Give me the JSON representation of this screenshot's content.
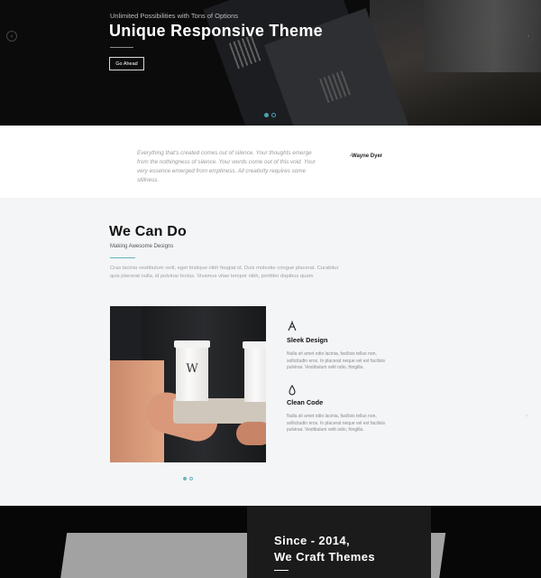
{
  "hero": {
    "kicker": "Unlimited Possibilities with Tons of Options",
    "title": "Unique Responsive Theme",
    "button_label": "Go Ahead",
    "prev_icon": "chevron-left-icon",
    "next_icon": "chevron-right-icon",
    "slides": 2,
    "active_slide": 1
  },
  "quote": {
    "text": "Everything that's created comes out of silence. Your thoughts emerge from the nothingness of silence. Your words come out of this void. Your very essence emerged from emptiness. All creativity requires some stillness.",
    "author": "-Wayne Dyer"
  },
  "services": {
    "title": "We Can Do",
    "subtitle": "Making Awesome Designs",
    "description": "Cras lacinia vestibulum velit, eget tristique nibh feugiat id. Duis molestie congue placerat. Curabitur quis placerat nulla, id pulvinar lectus. Vivamus vitae tempor nibh, porttitor dapibus quam",
    "features": [
      {
        "icon": "drafting-compass-icon",
        "title": "Sleek Design",
        "text": "Nulla sit amet odio lacinia, facilisis tellus non, sollicitudin eros. In placerat neque vel est facilisis pulvinar. Vestibulum velit odio, fringilla."
      },
      {
        "icon": "droplet-icon",
        "title": "Clean Code",
        "text": "Nulla sit amet odio lacinia, facilisis tellus non, sollicitudin eros. In placerat neque vel est facilisis pulvinar. Vestibulum velit odio, fringilla."
      }
    ],
    "slides": 2,
    "active_slide": 1
  },
  "since": {
    "line1": "Since - 2014,",
    "line2": "We Craft Themes"
  },
  "colors": {
    "accent": "#4aa3b0",
    "dark": "#0b0b0c",
    "light_bg": "#f4f5f7"
  }
}
